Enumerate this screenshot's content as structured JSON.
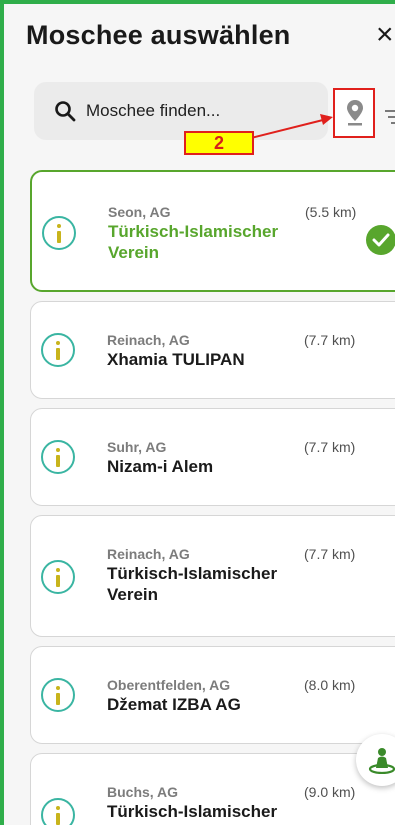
{
  "header": {
    "title": "Moschee auswählen",
    "close_symbol": "×"
  },
  "search": {
    "placeholder": "Moschee finden..."
  },
  "annotation": {
    "label": "2"
  },
  "mosques": [
    {
      "city": "Seon, AG",
      "name_lines": [
        "Türkisch-Islamischer",
        "Verein"
      ],
      "distance": "(5.5 km)",
      "selected": true
    },
    {
      "city": "Reinach, AG",
      "name_lines": [
        "Xhamia TULIPAN"
      ],
      "distance": "(7.7 km)",
      "selected": false
    },
    {
      "city": "Suhr, AG",
      "name_lines": [
        "Nizam-i Alem"
      ],
      "distance": "(7.7 km)",
      "selected": false
    },
    {
      "city": "Reinach, AG",
      "name_lines": [
        "Türkisch-Islamischer",
        "Verein"
      ],
      "distance": "(7.7 km)",
      "selected": false
    },
    {
      "city": "Oberentfelden, AG",
      "name_lines": [
        "Džemat IZBA AG"
      ],
      "distance": "(8.0 km)",
      "selected": false
    },
    {
      "city": "Buchs, AG",
      "name_lines": [
        "Türkisch-Islamischer"
      ],
      "distance": "(9.0 km)",
      "selected": false
    }
  ],
  "colors": {
    "accent_green": "#58a62d",
    "frame_green": "#2fae4a",
    "annotation_red": "#e0201c",
    "annotation_yellow": "#ffff00",
    "info_teal": "#3ab5a2"
  },
  "icons": {
    "search": "search-icon",
    "location": "location-pin-icon",
    "filter": "filter-icon",
    "info": "info-icon",
    "check": "check-circle-icon",
    "fab": "person-location-icon"
  }
}
